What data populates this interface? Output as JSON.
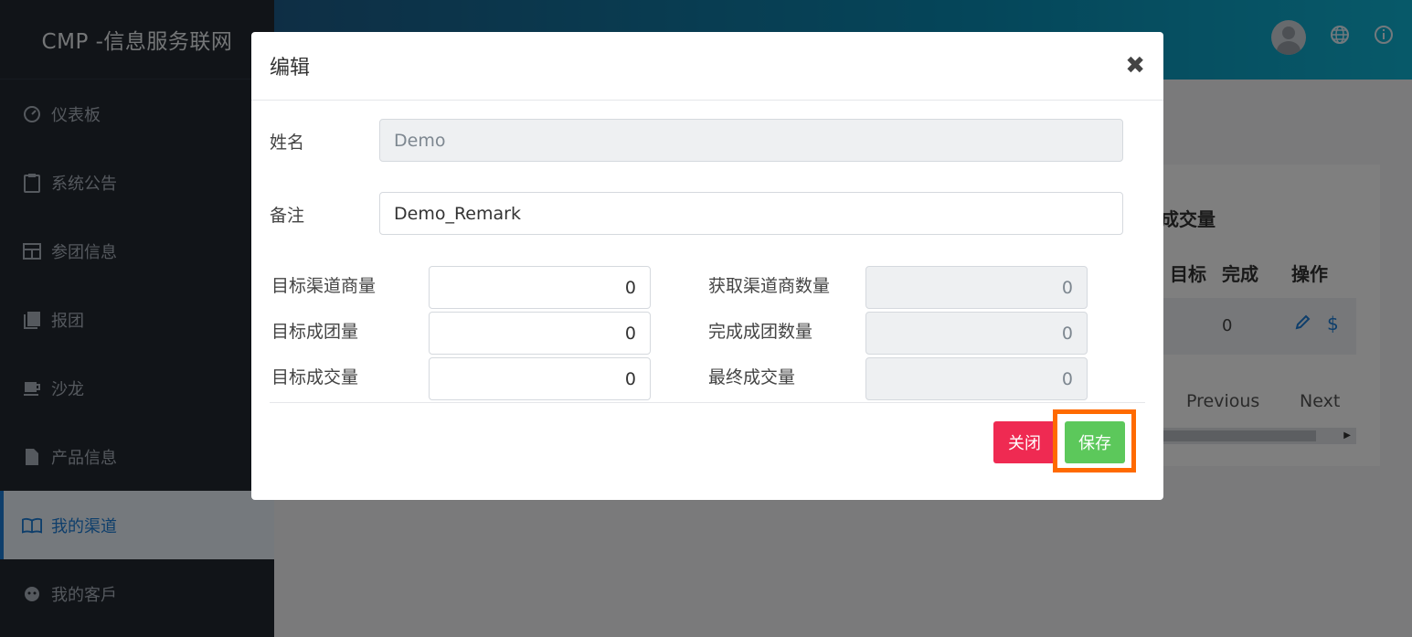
{
  "app": {
    "brand": "CMP -信息服务联网"
  },
  "sidebar": {
    "items": [
      {
        "label": "仪表板",
        "icon": "dashboard-icon"
      },
      {
        "label": "系统公告",
        "icon": "clipboard-icon"
      },
      {
        "label": "参团信息",
        "icon": "table-icon"
      },
      {
        "label": "报团",
        "icon": "book-stack-icon"
      },
      {
        "label": "沙龙",
        "icon": "coffee-icon"
      },
      {
        "label": "产品信息",
        "icon": "file-icon"
      },
      {
        "label": "我的渠道",
        "icon": "open-book-icon",
        "active": true
      },
      {
        "label": "我的客戶",
        "icon": "face-icon"
      }
    ]
  },
  "background_card": {
    "title": "成交量",
    "headers": [
      "目标",
      "完成",
      "操作"
    ],
    "row": {
      "done": "0"
    },
    "pager": {
      "previous": "Previous",
      "next": "Next"
    }
  },
  "modal": {
    "title": "编辑",
    "name_label": "姓名",
    "name_value": "Demo",
    "remark_label": "备注",
    "remark_value": "Demo_Remark",
    "left_fields": [
      {
        "label": "目标渠道商量",
        "value": "0"
      },
      {
        "label": "目标成团量",
        "value": "0"
      },
      {
        "label": "目标成交量",
        "value": "0"
      }
    ],
    "right_fields": [
      {
        "label": "获取渠道商数量",
        "value": "0"
      },
      {
        "label": "完成成团数量",
        "value": "0"
      },
      {
        "label": "最终成交量",
        "value": "0"
      }
    ],
    "close_label": "关闭",
    "save_label": "保存"
  },
  "colors": {
    "sidebar_bg": "#232830",
    "active_accent": "#1c7cd6",
    "close_button": "#ef2a52",
    "save_button": "#5cc85b",
    "highlight": "#ff6a00"
  }
}
